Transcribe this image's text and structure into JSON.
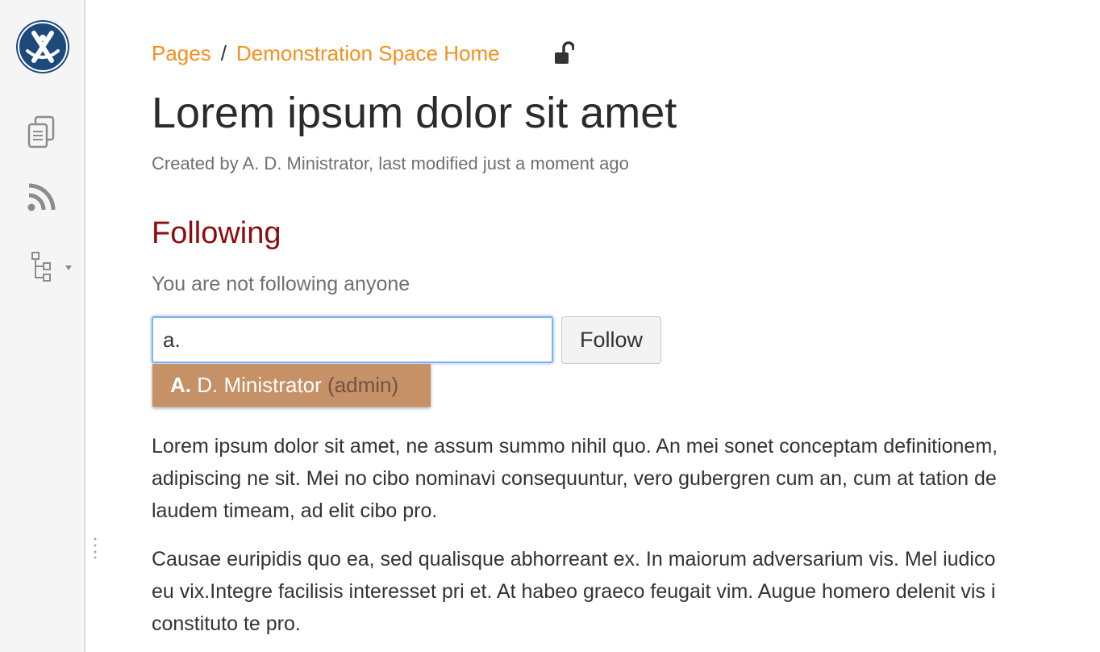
{
  "sidebar": {
    "logo_icon": "confluence-logo-icon",
    "items": [
      {
        "icon": "pages-icon"
      },
      {
        "icon": "rss-feed-icon"
      },
      {
        "icon": "page-tree-icon"
      }
    ],
    "logo_color": "#1d4a7a"
  },
  "breadcrumb": {
    "items": [
      "Pages",
      "Demonstration Space Home"
    ],
    "separator": "/",
    "lock_icon": "unlock-icon",
    "link_color": "#f5901e"
  },
  "page": {
    "title": "Lorem ipsum dolor sit amet",
    "byline": "Created by A. D. Ministrator, last modified just a moment ago"
  },
  "following": {
    "heading": "Following",
    "heading_color": "#8b0c0c",
    "status": "You are not following anyone",
    "input_value": "a.",
    "button_label": "Follow",
    "suggestion": {
      "match": "A.",
      "rest": " D. Ministrator",
      "username": "(admin)",
      "bg_color": "#c69166"
    }
  },
  "content": {
    "paragraphs": [
      [
        "Lorem ipsum dolor sit amet, ne assum summo nihil quo. An mei sonet conceptam definitionem,",
        "adipiscing ne sit. Mei no cibo nominavi consequuntur, vero gubergren cum an, cum at tation de",
        "laudem timeam, ad elit cibo pro."
      ],
      [
        "Causae euripidis quo ea, sed qualisque abhorreant ex. In maiorum adversarium vis. Mel iudico",
        "eu vix.Integre facilisis interesset pri et. At habeo graeco feugait vim. Augue homero delenit vis i",
        "constituto te pro."
      ]
    ]
  }
}
